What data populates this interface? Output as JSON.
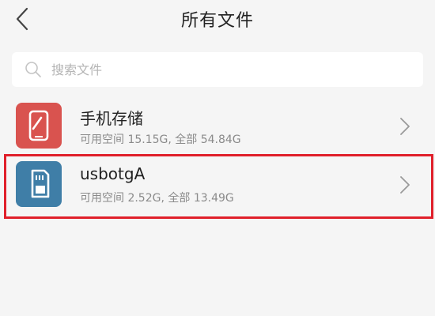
{
  "header": {
    "title": "所有文件",
    "back_icon": "chevron-left-icon"
  },
  "search": {
    "placeholder": "搜索文件",
    "value": "",
    "icon": "search-icon"
  },
  "storage_items": [
    {
      "name": "手机存储",
      "detail": "可用空间 15.15G, 全部 54.84G",
      "icon": "phone-icon",
      "icon_color": "#d9534f"
    },
    {
      "name": "usbotgA",
      "detail": "可用空间 2.52G, 全部 13.49G",
      "icon": "sd-card-icon",
      "icon_color": "#3f7ea7",
      "highlighted": true
    }
  ],
  "colors": {
    "background": "#f5f5f5",
    "highlight_border": "#e01f2a"
  }
}
